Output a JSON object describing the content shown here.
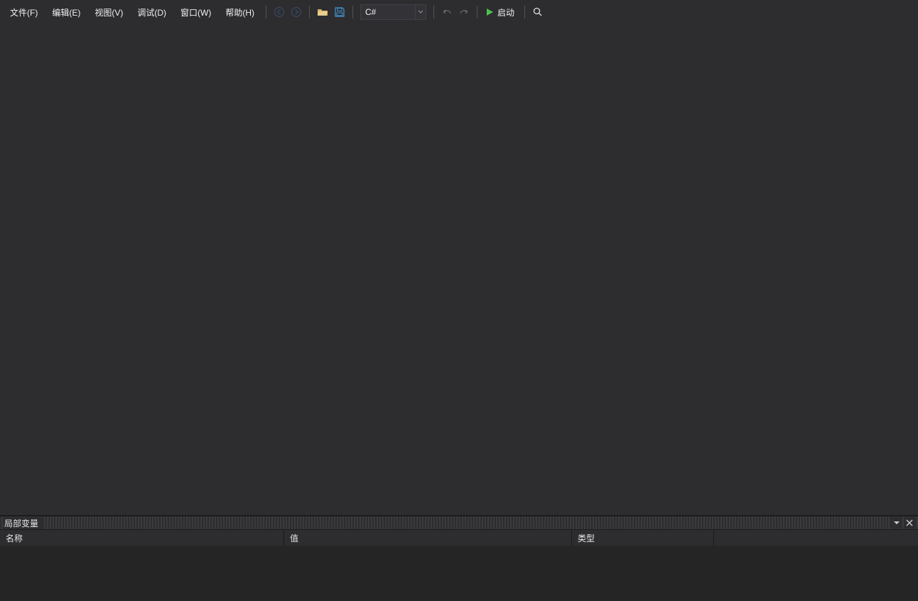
{
  "menu": {
    "file": "文件(F)",
    "edit": "编辑(E)",
    "view": "视图(V)",
    "debug": "调试(D)",
    "window": "窗口(W)",
    "help": "帮助(H)"
  },
  "toolbar": {
    "language_selected": "C#",
    "start_label": "启动"
  },
  "panel": {
    "title": "局部变量",
    "columns": {
      "name": "名称",
      "value": "值",
      "type": "类型"
    },
    "rows": []
  }
}
